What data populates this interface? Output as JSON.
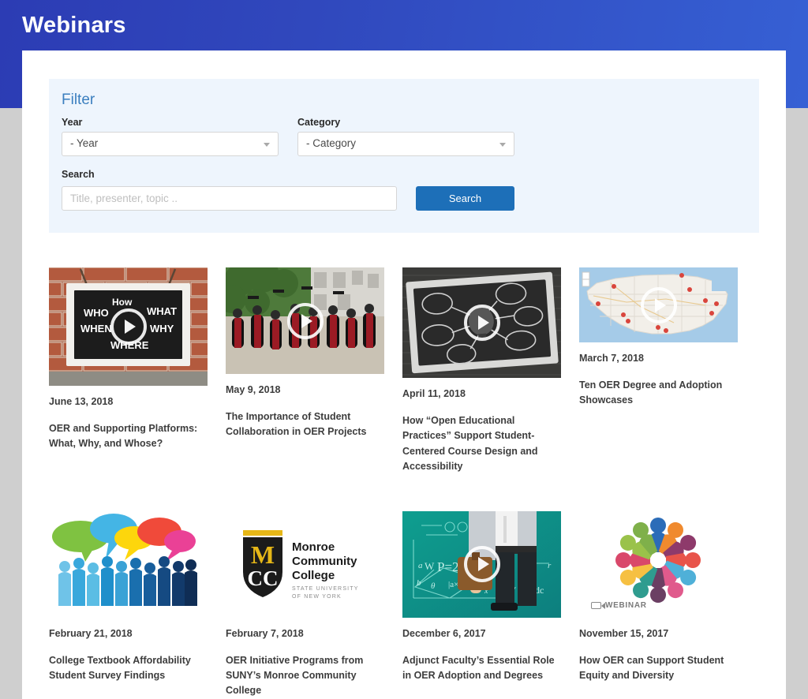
{
  "header": {
    "title": "Webinars",
    "bg_color": "#3048bd"
  },
  "filter": {
    "legend": "Filter",
    "year": {
      "label": "Year",
      "value": "- Year"
    },
    "category": {
      "label": "Category",
      "value": "- Category"
    },
    "search": {
      "label": "Search",
      "placeholder": "Title, presenter, topic ..",
      "value": ""
    },
    "search_button": "Search",
    "panel_bg": "#eef5fd",
    "button_color": "#1d6fb8"
  },
  "webinars": [
    {
      "date": "June 13, 2018",
      "title": "OER and Supporting Platforms: What, Why, and Whose?",
      "thumb": "chalkboard-brick-wall",
      "has_play": true,
      "badge": ""
    },
    {
      "date": "May 9, 2018",
      "title": "The Importance of Student Collaboration in OER Projects",
      "thumb": "graduation-students-jumping",
      "has_play": true,
      "badge": ""
    },
    {
      "date": "April 11, 2018",
      "title": "How “Open Educational Practices” Support Student-Centered Course Design and Accessibility",
      "thumb": "chalkboard-mind-map",
      "has_play": true,
      "badge": ""
    },
    {
      "date": "March 7, 2018",
      "title": "Ten OER Degree and Adoption Showcases",
      "thumb": "usa-map-with-pins",
      "has_play": true,
      "badge": ""
    },
    {
      "date": "February 21, 2018",
      "title": "College Textbook Affordability Student Survey Findings",
      "thumb": "speech-bubbles-crowd",
      "has_play": false,
      "badge": ""
    },
    {
      "date": "February 7, 2018",
      "title": "OER Initiative Programs from SUNY’s Monroe Community College",
      "thumb": "monroe-community-college-logo",
      "has_play": false,
      "badge": ""
    },
    {
      "date": "December 6, 2017",
      "title": "Adjunct Faculty’s Essential Role in OER Adoption and Degrees",
      "thumb": "math-formulas-businessman",
      "has_play": true,
      "badge": ""
    },
    {
      "date": "November 15, 2017",
      "title": "How OER can Support Student Equity and Diversity",
      "thumb": "colorful-people-circle",
      "has_play": false,
      "badge": "WEBINAR"
    }
  ],
  "logo": {
    "mcc_line1": "Monroe",
    "mcc_line2": "Community",
    "mcc_line3": "College",
    "mcc_sub1": "STATE UNIVERSITY",
    "mcc_sub2": "OF NEW YORK",
    "mcc_mark_top": "M",
    "mcc_mark_bottom": "CC"
  }
}
